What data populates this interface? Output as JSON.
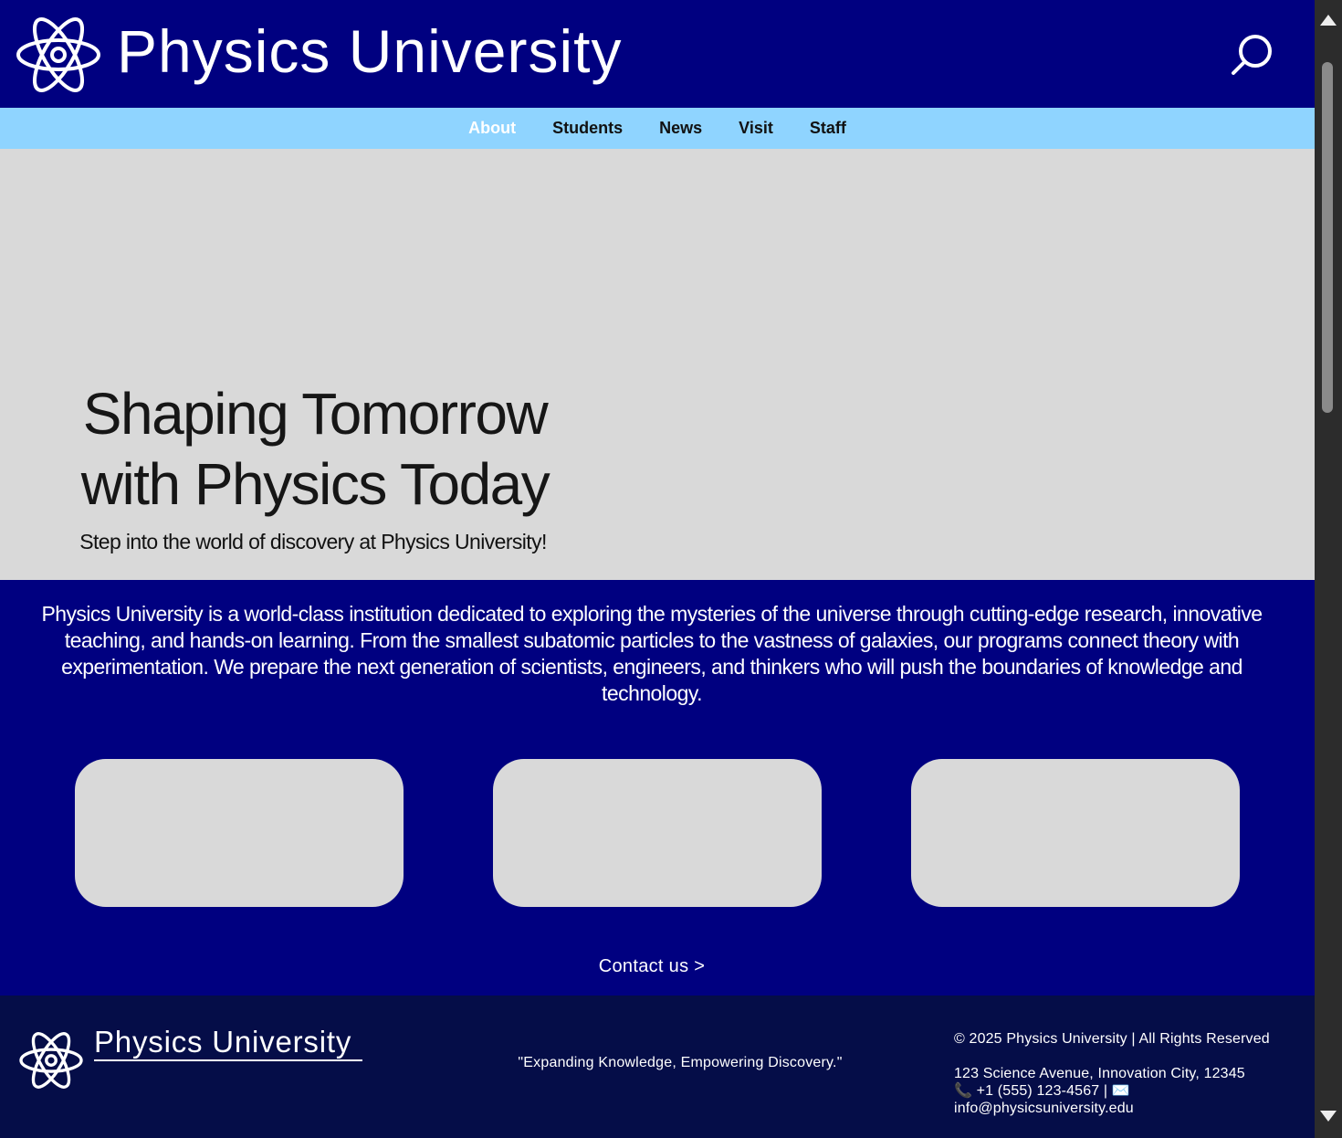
{
  "header": {
    "title": "Physics University",
    "logo_icon": "atom-icon",
    "search_icon": "search-icon"
  },
  "nav": {
    "items": [
      {
        "label": "About",
        "active": true
      },
      {
        "label": "Students",
        "active": false
      },
      {
        "label": "News",
        "active": false
      },
      {
        "label": "Visit",
        "active": false
      },
      {
        "label": "Staff",
        "active": false
      }
    ]
  },
  "hero": {
    "title_line1": "Shaping Tomorrow",
    "title_line2": "with Physics Today",
    "subtitle": "Step into the world of discovery at Physics University!"
  },
  "intro": {
    "text": "Physics University is a world-class institution dedicated to exploring the mysteries of the universe through cutting-edge research, innovative teaching, and hands-on learning. From the smallest subatomic particles to the vastness of galaxies, our programs connect theory with experimentation. We prepare the next generation of scientists, engineers, and thinkers who will push the boundaries of knowledge and technology."
  },
  "contact": {
    "label": "Contact us >"
  },
  "footer": {
    "title": "Physics University",
    "tagline": "\"Expanding Knowledge, Empowering Discovery.\"",
    "copyright": "© 2025 Physics University | All Rights Reserved",
    "address": "123 Science Avenue, Innovation City, 12345",
    "phone": "📞 +1 (555) 123-4567 | ✉️",
    "email": "info@physicsuniversity.edu"
  },
  "colors": {
    "primary": "#000080",
    "nav_bg": "#8fd4ff",
    "hero_bg": "#d9d9d9",
    "footer_bg": "#050d48",
    "scrollbar": "#2c2c2c"
  }
}
